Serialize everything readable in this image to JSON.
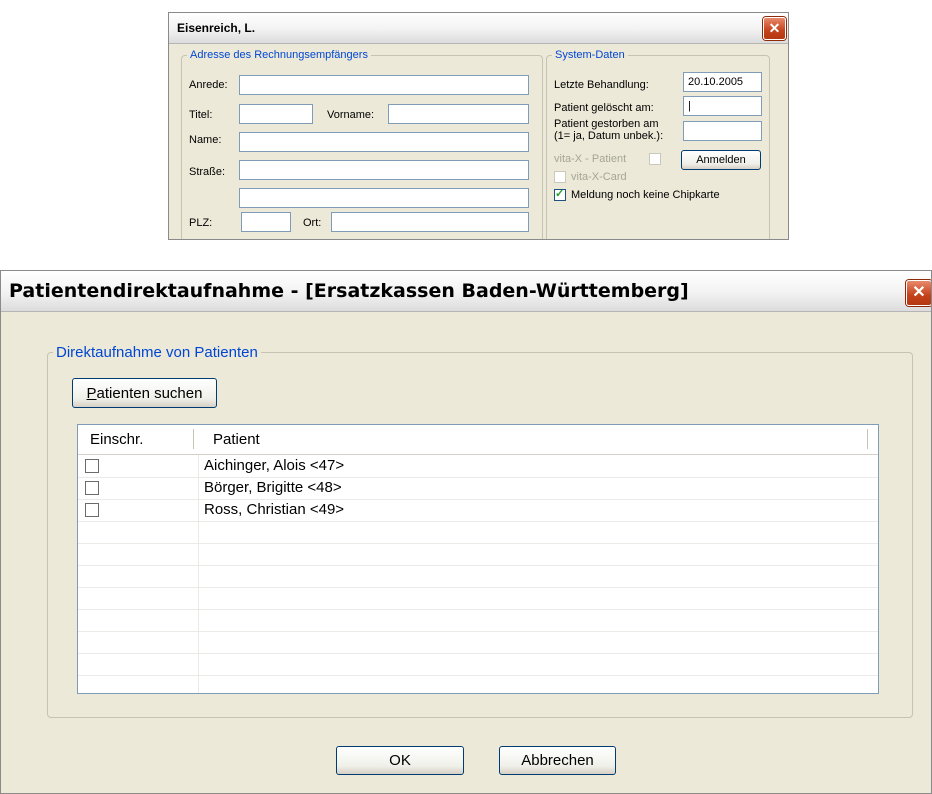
{
  "dialog1": {
    "title": "Eisenreich, L.",
    "address_group": {
      "legend": "Adresse des Rechnungsempfängers",
      "anrede_label": "Anrede:",
      "anrede_value": "",
      "titel_label": "Titel:",
      "titel_value": "",
      "vorname_label": "Vorname:",
      "vorname_value": "",
      "name_label": "Name:",
      "name_value": "",
      "strasse_label": "Straße:",
      "strasse_value": "",
      "strasse2_value": "",
      "plz_label": "PLZ:",
      "plz_value": "",
      "ort_label": "Ort:",
      "ort_value": ""
    },
    "system_group": {
      "legend": "System-Daten",
      "letzte_behandlung_label": "Letzte Behandlung:",
      "letzte_behandlung_value": "20.10.2005",
      "geloescht_label": "Patient gelöscht am:",
      "geloescht_value": "|",
      "gestorben_label_line1": "Patient gestorben am",
      "gestorben_label_line2": "(1= ja, Datum unbek.):",
      "gestorben_value": "",
      "vitax_patient_label": "vita-X - Patient",
      "vitax_card_label": "vita-X-Card",
      "anmelden_button": "Anmelden",
      "meldung_label": "Meldung noch keine Chipkarte",
      "meldung_checked": true
    }
  },
  "dialog2": {
    "title": "Patientendirektaufnahme - [Ersatzkassen Baden-Württemberg]",
    "group_legend": "Direktaufnahme von Patienten",
    "search_button_first": "P",
    "search_button_rest": "atienten suchen",
    "columns": [
      "Einschr.",
      "Patient"
    ],
    "rows": [
      {
        "checked": false,
        "patient": "Aichinger,  Alois <47>"
      },
      {
        "checked": false,
        "patient": "Börger,  Brigitte <48>"
      },
      {
        "checked": false,
        "patient": "Ross,  Christian <49>"
      }
    ],
    "ok_button": "OK",
    "cancel_button": "Abbrechen"
  }
}
